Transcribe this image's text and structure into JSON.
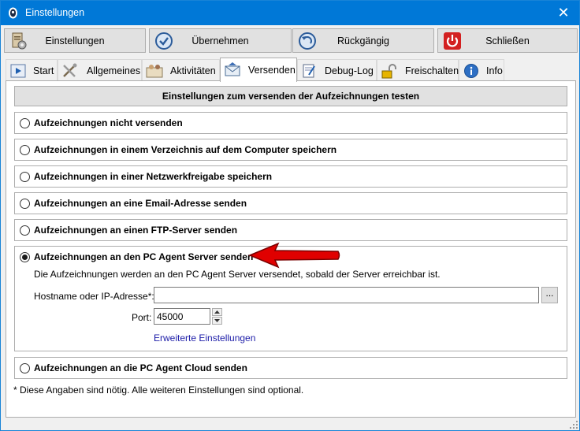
{
  "window": {
    "title": "Einstellungen",
    "close_glyph": "✕",
    "app_icon": "pc-agent-icon"
  },
  "toolbar": {
    "buttons": [
      {
        "label": "Einstellungen",
        "icon": "settings-document-icon"
      },
      {
        "label": "Übernehmen",
        "icon": "apply-clock-icon"
      },
      {
        "label": "Rückgängig",
        "icon": "undo-clock-icon"
      },
      {
        "label": "Schließen",
        "icon": "power-icon"
      }
    ]
  },
  "tabs": [
    {
      "label": "Start",
      "icon": "play-icon"
    },
    {
      "label": "Allgemeines",
      "icon": "tools-icon"
    },
    {
      "label": "Aktivitäten",
      "icon": "people-icon"
    },
    {
      "label": "Versenden",
      "icon": "mail-icon",
      "active": true
    },
    {
      "label": "Debug-Log",
      "icon": "notepad-icon"
    },
    {
      "label": "Freischalten",
      "icon": "unlock-icon"
    },
    {
      "label": "Info",
      "icon": "info-icon"
    }
  ],
  "panel": {
    "test_button": "Einstellungen zum versenden der Aufzeichnungen testen",
    "options": [
      {
        "label": "Aufzeichnungen nicht versenden",
        "selected": false
      },
      {
        "label": "Aufzeichnungen in einem Verzeichnis auf dem Computer speichern",
        "selected": false
      },
      {
        "label": "Aufzeichnungen in einer Netzwerkfreigabe speichern",
        "selected": false
      },
      {
        "label": "Aufzeichnungen an eine Email-Adresse senden",
        "selected": false
      },
      {
        "label": "Aufzeichnungen an einen FTP-Server senden",
        "selected": false
      },
      {
        "label": "Aufzeichnungen an den PC Agent Server senden",
        "selected": true
      },
      {
        "label": "Aufzeichnungen an die PC Agent Cloud senden",
        "selected": false
      }
    ],
    "server": {
      "description": "Die Aufzeichnungen werden an den PC Agent Server versendet, sobald der Server erreichbar ist.",
      "hostname_label": "Hostname oder IP-Adresse*:",
      "hostname_value": "",
      "browse_label": "...",
      "port_label": "Port:",
      "port_value": "45000",
      "advanced_link": "Erweiterte Einstellungen"
    },
    "annotation_arrow_color": "#e00000"
  },
  "footnote": "* Diese Angaben sind nötig. Alle weiteren Einstellungen sind optional."
}
